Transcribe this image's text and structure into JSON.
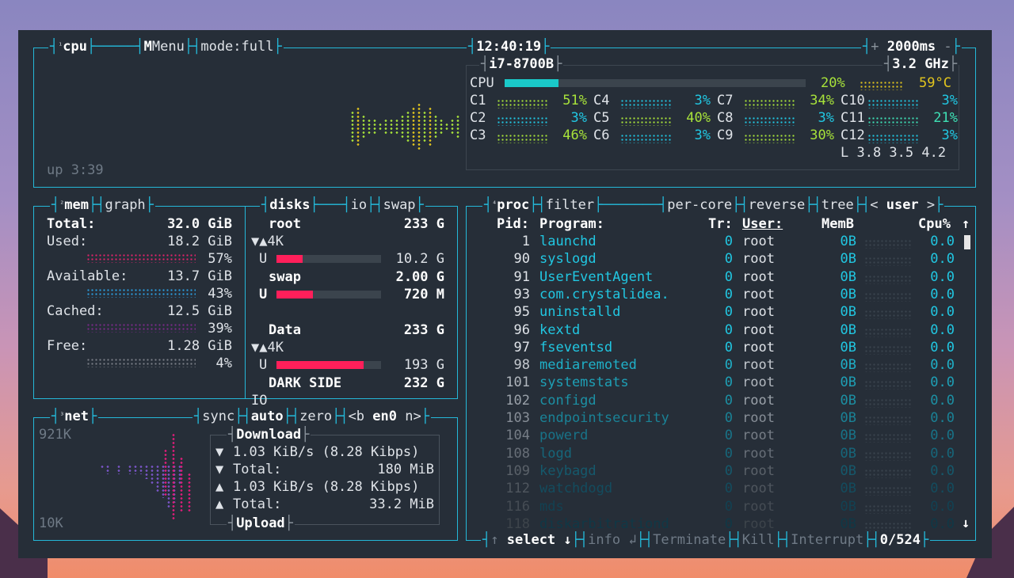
{
  "cpu": {
    "header": {
      "title": "cpu",
      "menu": "Menu",
      "mode": "mode:full",
      "clock": "12:40:19",
      "interval": "2000ms",
      "plus": "+",
      "minus": "-"
    },
    "model": "i7-8700B",
    "freq": "3.2 GHz",
    "total": {
      "label": "CPU",
      "pct": "20%",
      "temp": "59°C",
      "fraction": 0.2
    },
    "cores": [
      {
        "label": "C1",
        "pct": "51%",
        "color": "#a8e33a"
      },
      {
        "label": "C2",
        "pct": "3%",
        "color": "#21c7e2"
      },
      {
        "label": "C3",
        "pct": "46%",
        "color": "#a8e33a"
      },
      {
        "label": "C4",
        "pct": "3%",
        "color": "#21c7e2"
      },
      {
        "label": "C5",
        "pct": "40%",
        "color": "#a8e33a"
      },
      {
        "label": "C6",
        "pct": "3%",
        "color": "#21c7e2"
      },
      {
        "label": "C7",
        "pct": "34%",
        "color": "#a8e33a"
      },
      {
        "label": "C8",
        "pct": "3%",
        "color": "#21c7e2"
      },
      {
        "label": "C9",
        "pct": "30%",
        "color": "#a8e33a"
      },
      {
        "label": "C10",
        "pct": "3%",
        "color": "#21c7e2"
      },
      {
        "label": "C11",
        "pct": "21%",
        "color": "#3ee0b5"
      },
      {
        "label": "C12",
        "pct": "3%",
        "color": "#21c7e2"
      }
    ],
    "load": "L 3.8 3.5 4.2",
    "uptime": "up 3:39"
  },
  "mem": {
    "header": {
      "title": "mem",
      "graph": "graph",
      "disks": "disks",
      "io": "io",
      "swap": "swap"
    },
    "rows": [
      {
        "label": "Total:",
        "value": "32.0 GiB"
      },
      {
        "label": "Used:",
        "value": "18.2 GiB",
        "pct": "57%",
        "color": "#e0226a"
      },
      {
        "label": "Available:",
        "value": "13.7 GiB",
        "pct": "43%",
        "color": "#2b9fe0"
      },
      {
        "label": "Cached:",
        "value": "12.5 GiB",
        "pct": "39%",
        "color": "#7a2a8a"
      },
      {
        "label": "Free:",
        "value": "1.28 GiB",
        "pct": "4%",
        "color": "#7a7f88"
      }
    ],
    "disks": [
      {
        "name": "root",
        "size": "233 G",
        "io": "▼▲4K",
        "used_label": "U",
        "used": "10.2 G",
        "fraction": 0.25
      },
      {
        "name": "swap",
        "size": "2.00 G",
        "io": "",
        "used_label": "U",
        "used": "720 M",
        "fraction": 0.35
      },
      {
        "name": "Data",
        "size": "233 G",
        "io": "▼▲4K",
        "used_label": "U",
        "used": "193 G",
        "fraction": 0.83
      },
      {
        "name": "DARK SIDE",
        "size": "232 G",
        "io": "IO",
        "used_label": "",
        "used": "",
        "fraction": 0
      }
    ]
  },
  "net": {
    "header": {
      "title": "net",
      "sync": "sync",
      "auto": "auto",
      "zero": "zero",
      "prev": "<b",
      "iface": "en0",
      "next": "n>"
    },
    "scale_top": "921K",
    "scale_bottom": "10K",
    "download_title": "Download",
    "upload_title": "Upload",
    "rows": [
      {
        "arrow": "▼",
        "label": "1.03 KiB/s (8.28 Kibps)",
        "value": ""
      },
      {
        "arrow": "▼",
        "label": "Total:",
        "value": "180 MiB"
      },
      {
        "arrow": "▲",
        "label": "1.03 KiB/s (8.28 Kibps)",
        "value": ""
      },
      {
        "arrow": "▲",
        "label": "Total:",
        "value": "33.2 MiB"
      }
    ]
  },
  "proc": {
    "header": {
      "title": "proc",
      "filter": "filter",
      "percore": "per-core",
      "reverse": "reverse",
      "tree": "tree",
      "prev": "<",
      "sort": "user",
      "next": ">"
    },
    "columns": {
      "pid": "Pid:",
      "program": "Program:",
      "tr": "Tr:",
      "user": "User:",
      "mem": "MemB",
      "cpu": "Cpu%",
      "scroll_up": "↑",
      "scroll_down": "↓"
    },
    "rows": [
      {
        "pid": "1",
        "program": "launchd",
        "tr": "0",
        "user": "root",
        "mem": "0B",
        "cpu": "0.0"
      },
      {
        "pid": "90",
        "program": "syslogd",
        "tr": "0",
        "user": "root",
        "mem": "0B",
        "cpu": "0.0"
      },
      {
        "pid": "91",
        "program": "UserEventAgent",
        "tr": "0",
        "user": "root",
        "mem": "0B",
        "cpu": "0.0"
      },
      {
        "pid": "93",
        "program": "com.crystalidea.",
        "tr": "0",
        "user": "root",
        "mem": "0B",
        "cpu": "0.0"
      },
      {
        "pid": "95",
        "program": "uninstalld",
        "tr": "0",
        "user": "root",
        "mem": "0B",
        "cpu": "0.0"
      },
      {
        "pid": "96",
        "program": "kextd",
        "tr": "0",
        "user": "root",
        "mem": "0B",
        "cpu": "0.0"
      },
      {
        "pid": "97",
        "program": "fseventsd",
        "tr": "0",
        "user": "root",
        "mem": "0B",
        "cpu": "0.0"
      },
      {
        "pid": "98",
        "program": "mediaremoted",
        "tr": "0",
        "user": "root",
        "mem": "0B",
        "cpu": "0.0"
      },
      {
        "pid": "101",
        "program": "systemstats",
        "tr": "0",
        "user": "root",
        "mem": "0B",
        "cpu": "0.0"
      },
      {
        "pid": "102",
        "program": "configd",
        "tr": "0",
        "user": "root",
        "mem": "0B",
        "cpu": "0.0"
      },
      {
        "pid": "103",
        "program": "endpointsecurity",
        "tr": "0",
        "user": "root",
        "mem": "0B",
        "cpu": "0.0"
      },
      {
        "pid": "104",
        "program": "powerd",
        "tr": "0",
        "user": "root",
        "mem": "0B",
        "cpu": "0.0"
      },
      {
        "pid": "108",
        "program": "logd",
        "tr": "0",
        "user": "root",
        "mem": "0B",
        "cpu": "0.0"
      },
      {
        "pid": "109",
        "program": "keybagd",
        "tr": "0",
        "user": "root",
        "mem": "0B",
        "cpu": "0.0"
      },
      {
        "pid": "112",
        "program": "watchdogd",
        "tr": "0",
        "user": "root",
        "mem": "0B",
        "cpu": "0.0"
      },
      {
        "pid": "116",
        "program": "mds",
        "tr": "0",
        "user": "root",
        "mem": "0B",
        "cpu": "0.0"
      },
      {
        "pid": "118",
        "program": "diskarbitrationd",
        "tr": "0",
        "user": "root",
        "mem": "0B",
        "cpu": "0.0"
      }
    ],
    "footer": {
      "up": "↑",
      "select": "select",
      "down": "↓",
      "info": "info",
      "enter": "↲",
      "terminate": "Terminate",
      "kill": "Kill",
      "interrupt": "Interrupt",
      "count": "0/524"
    }
  }
}
